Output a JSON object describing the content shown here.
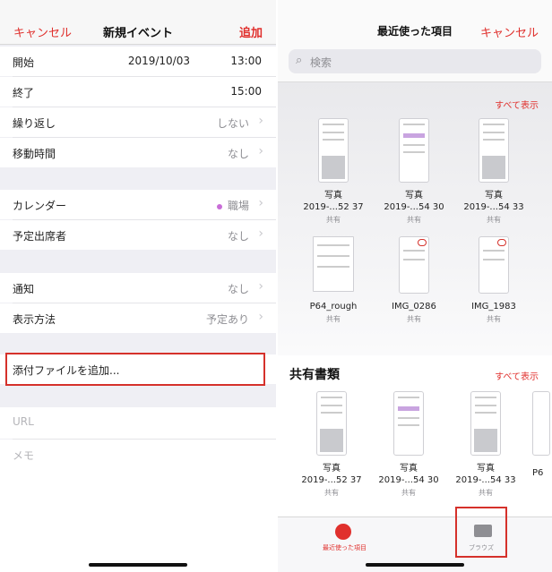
{
  "left": {
    "cancel": "キャンセル",
    "title": "新規イベント",
    "add": "追加",
    "start": {
      "label": "開始",
      "date": "2019/10/03",
      "time": "13:00"
    },
    "end": {
      "label": "終了",
      "time": "15:00"
    },
    "repeat": {
      "label": "繰り返し",
      "value": "しない"
    },
    "travel": {
      "label": "移動時間",
      "value": "なし"
    },
    "calendar": {
      "label": "カレンダー",
      "value": "職場"
    },
    "invitees": {
      "label": "予定出席者",
      "value": "なし"
    },
    "alert": {
      "label": "通知",
      "value": "なし"
    },
    "showas": {
      "label": "表示方法",
      "value": "予定あり"
    },
    "attach": "添付ファイルを追加...",
    "url": "URL",
    "notes": "メモ"
  },
  "right": {
    "title": "最近使った項目",
    "cancel": "キャンセル",
    "search_placeholder": "検索",
    "see_all": "すべて表示",
    "recent": [
      {
        "name": "写真",
        "name2": "2019-...52 37",
        "sub": "共有"
      },
      {
        "name": "写真",
        "name2": "2019-...54 30",
        "sub": "共有"
      },
      {
        "name": "写真",
        "name2": "2019-...54 33",
        "sub": "共有"
      },
      {
        "name": "P64_rough",
        "sub": "共有"
      },
      {
        "name": "IMG_0286",
        "sub": "共有"
      },
      {
        "name": "IMG_1983",
        "sub": "共有"
      }
    ],
    "shared_title": "共有書類",
    "shared_see_all": "すべて表示",
    "shared": [
      {
        "name": "写真",
        "name2": "2019-...52 37",
        "sub": "共有"
      },
      {
        "name": "写真",
        "name2": "2019-...54 30",
        "sub": "共有"
      },
      {
        "name": "写真",
        "name2": "2019-...54 33",
        "sub": "共有"
      },
      {
        "name": "P6"
      }
    ],
    "tab_recent": "最近使った項目",
    "tab_browse": "ブラウズ"
  },
  "colors": {
    "accent": "#e0302d",
    "highlight_box": "#d5312b",
    "calendar_dot": "#c86dd7"
  }
}
